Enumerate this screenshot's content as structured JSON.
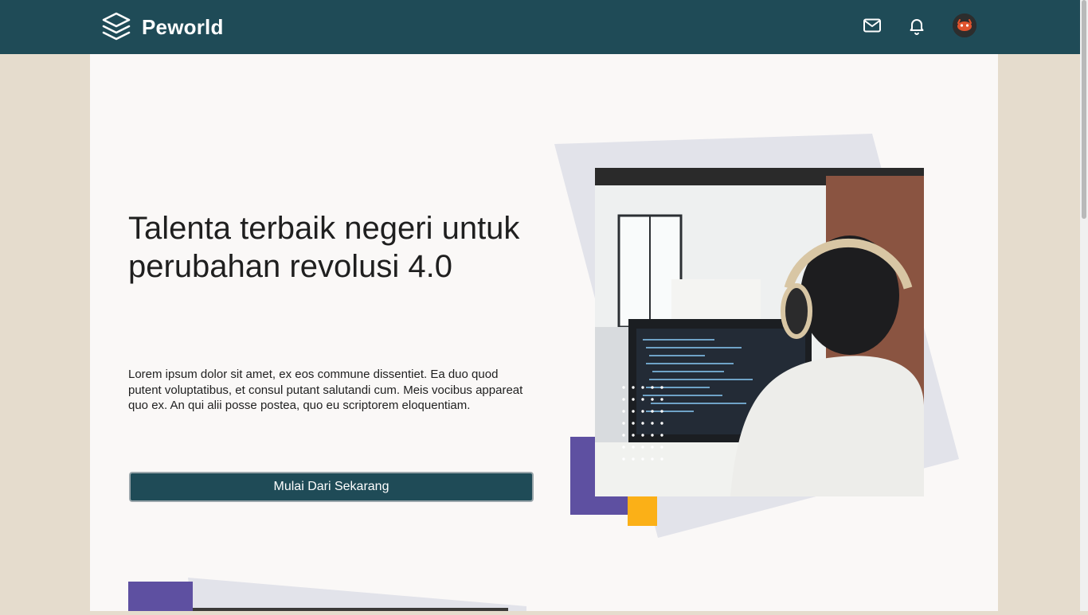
{
  "navbar": {
    "brand_name": "Peworld",
    "icons": [
      "layers-logo-icon",
      "mail-icon",
      "bell-icon",
      "avatar"
    ]
  },
  "hero": {
    "title": "Talenta terbaik negeri untuk perubahan revolusi 4.0",
    "description": "Lorem ipsum dolor sit amet, ex eos commune dissentiet. Ea duo quod putent voluptatibus, et consul putant salutandi cum. Meis vocibus appareat quo ex. An qui alii posse postea, quo eu scriptorem eloquentiam.",
    "cta_label": "Mulai Dari Sekarang"
  },
  "colors": {
    "navbar": "#1f4b57",
    "page_background": "#e5dccd",
    "content_background": "#faf8f7",
    "accent_purple": "#5e50a1",
    "accent_yellow": "#fbb017",
    "shape_gray": "#e2e3ea"
  }
}
